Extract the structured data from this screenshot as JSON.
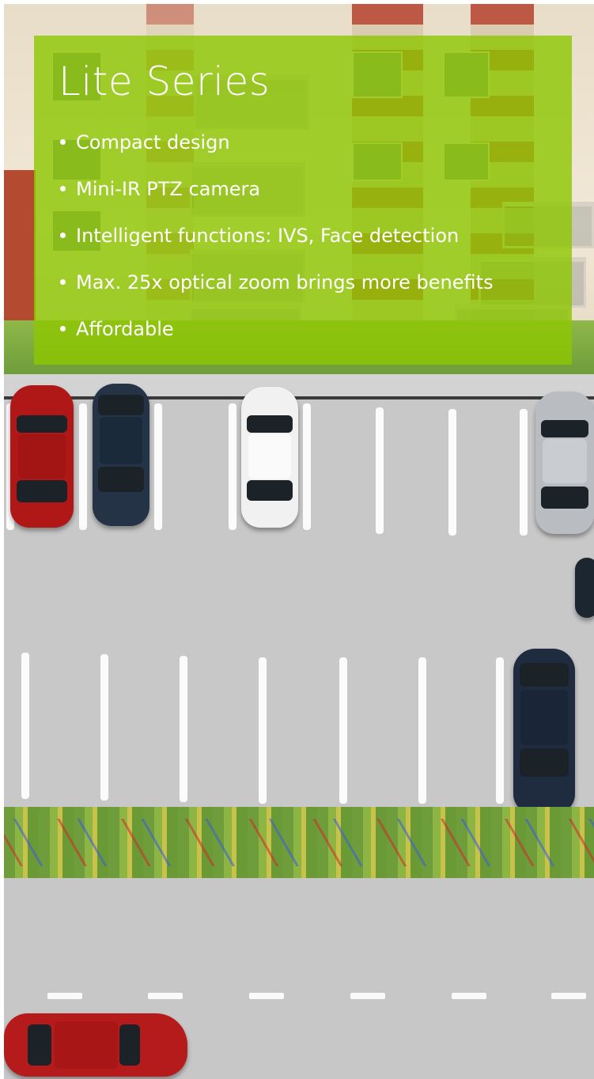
{
  "slide": {
    "title": "Lite Series",
    "bullets": [
      "Compact design",
      "Mini-IR PTZ camera",
      "Intelligent functions: IVS, Face detection",
      "Max. 25x optical zoom brings more benefits",
      "Affordable"
    ],
    "panel_color": "#8DC700"
  },
  "background": {
    "description_icon": "parking-lot-model-photo"
  }
}
